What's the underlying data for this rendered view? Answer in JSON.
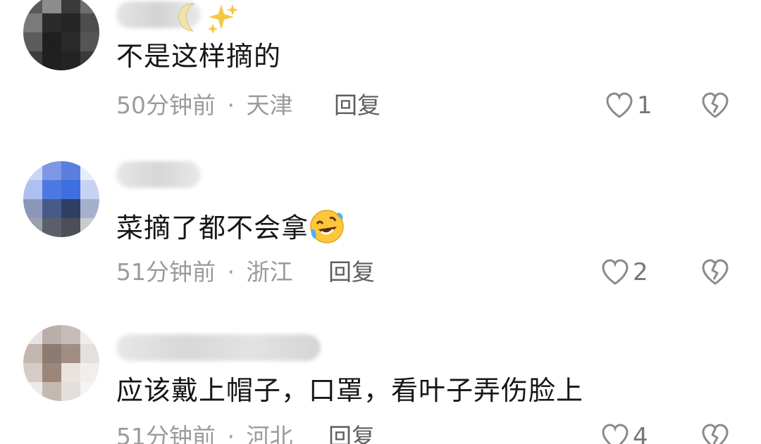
{
  "comments": [
    {
      "text": "不是这样摘的",
      "time": "50分钟前",
      "separator": "·",
      "location": "天津",
      "reply_label": "回复",
      "likes": "1",
      "username_emojis": [
        "crescent-moon",
        "sparkles"
      ]
    },
    {
      "text": "菜摘了都不会拿",
      "emoji": "rolling-laughing",
      "time": "51分钟前",
      "separator": "·",
      "location": "浙江",
      "reply_label": "回复",
      "likes": "2"
    },
    {
      "text": "应该戴上帽子，口罩，看叶子弄伤脸上",
      "time": "51分钟前",
      "separator": "·",
      "location": "河北",
      "reply_label": "回复",
      "likes": "4"
    }
  ],
  "icons": {
    "like": "heart-outline-icon",
    "dislike": "broken-heart-icon"
  },
  "colors": {
    "meta_text": "#9b9b9b",
    "reply_text": "#5e5e5e",
    "icon_stroke": "#8a8a8a"
  }
}
